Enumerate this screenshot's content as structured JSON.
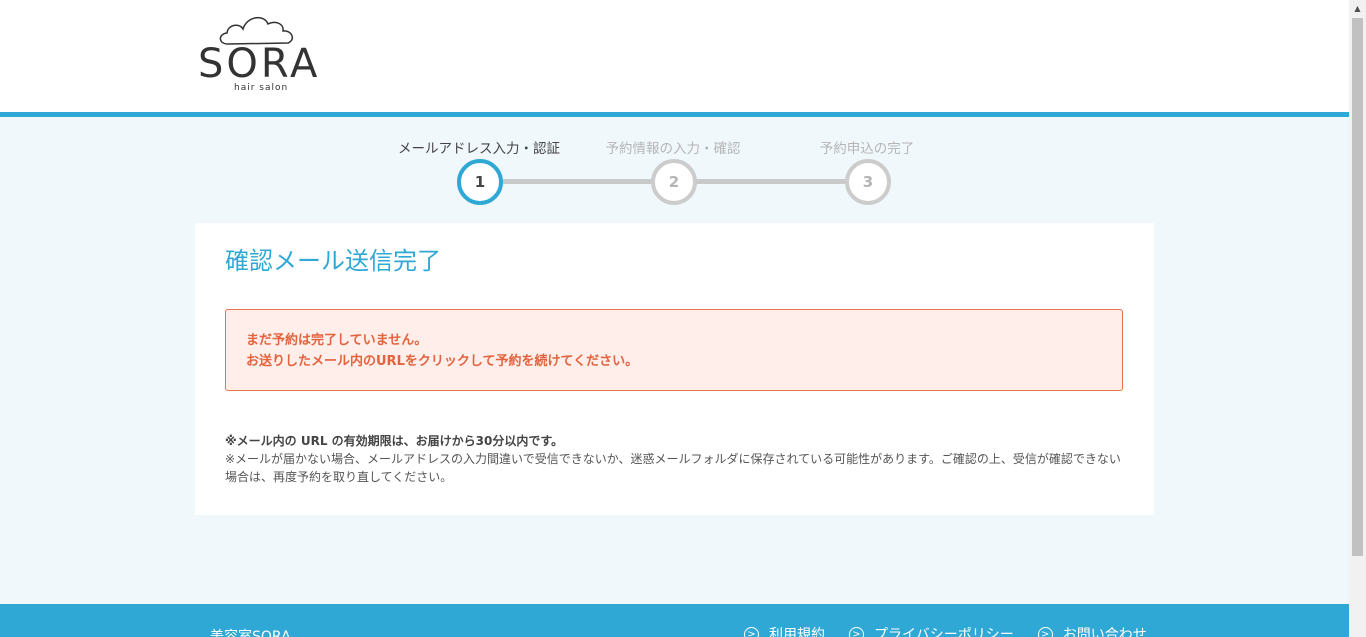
{
  "logo": {
    "name": "SORA",
    "sub": "hair salon"
  },
  "steps": [
    {
      "label": "メールアドレス入力・認証",
      "number": "1",
      "active": true
    },
    {
      "label": "予約情報の入力・確認",
      "number": "2",
      "active": false
    },
    {
      "label": "予約申込の完了",
      "number": "3",
      "active": false
    }
  ],
  "card": {
    "title": "確認メール送信完了",
    "alert": {
      "line1": "まだ予約は完了していません。",
      "line2": "お送りしたメール内のURLをクリックして予約を続けてください。"
    },
    "note_strong": "※メール内の URL の有効期限は、お届けから30分以内です。",
    "note": "※メールが届かない場合、メールアドレスの入力間違いで受信できないか、迷惑メールフォルダに保存されている可能性があります。ご確認の上、受信が確認できない場合は、再度予約を取り直してください。"
  },
  "footer": {
    "brand": "美容室SORA",
    "links": [
      "利用規約",
      "プライバシーポリシー",
      "お問い合わせ"
    ]
  },
  "colors": {
    "accent": "#2fa8d6",
    "alert_text": "#e2633d",
    "alert_bg": "#ffeeea"
  }
}
